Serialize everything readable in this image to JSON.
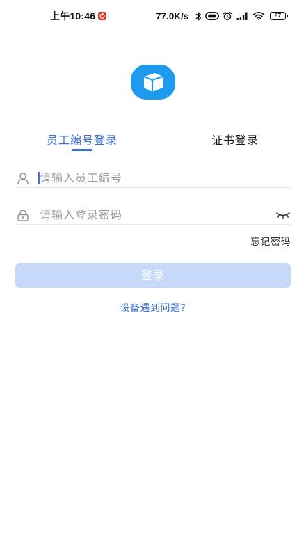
{
  "status_bar": {
    "time": "上午10:46",
    "network_speed": "77.0K/s",
    "battery_level": "87",
    "notification_icon": "music-app-notification-icon",
    "system_icons": [
      "bluetooth-icon",
      "hd-voice-icon",
      "alarm-icon",
      "signal-icon",
      "wifi-icon",
      "battery-icon"
    ]
  },
  "logo": {
    "icon": "cube-logo-icon"
  },
  "tabs": [
    {
      "label": "员工编号登录",
      "active": true
    },
    {
      "label": "证书登录",
      "active": false
    }
  ],
  "form": {
    "employee_id": {
      "icon": "user-icon",
      "placeholder": "请输入员工编号",
      "value": ""
    },
    "password": {
      "icon": "lock-icon",
      "placeholder": "请输入登录密码",
      "value": "",
      "visibility_toggle_icon": "eye-closed-icon"
    },
    "forgot_password_label": "忘记密码",
    "submit_label": "登录",
    "submit_enabled": false
  },
  "help_link_label": "设备遇到问题?",
  "colors": {
    "accent": "#3b6fd9",
    "submit_disabled_bg": "#c6d9fb",
    "logo_blue": "#1e9bf1",
    "placeholder_text": "#9b9b9b"
  }
}
